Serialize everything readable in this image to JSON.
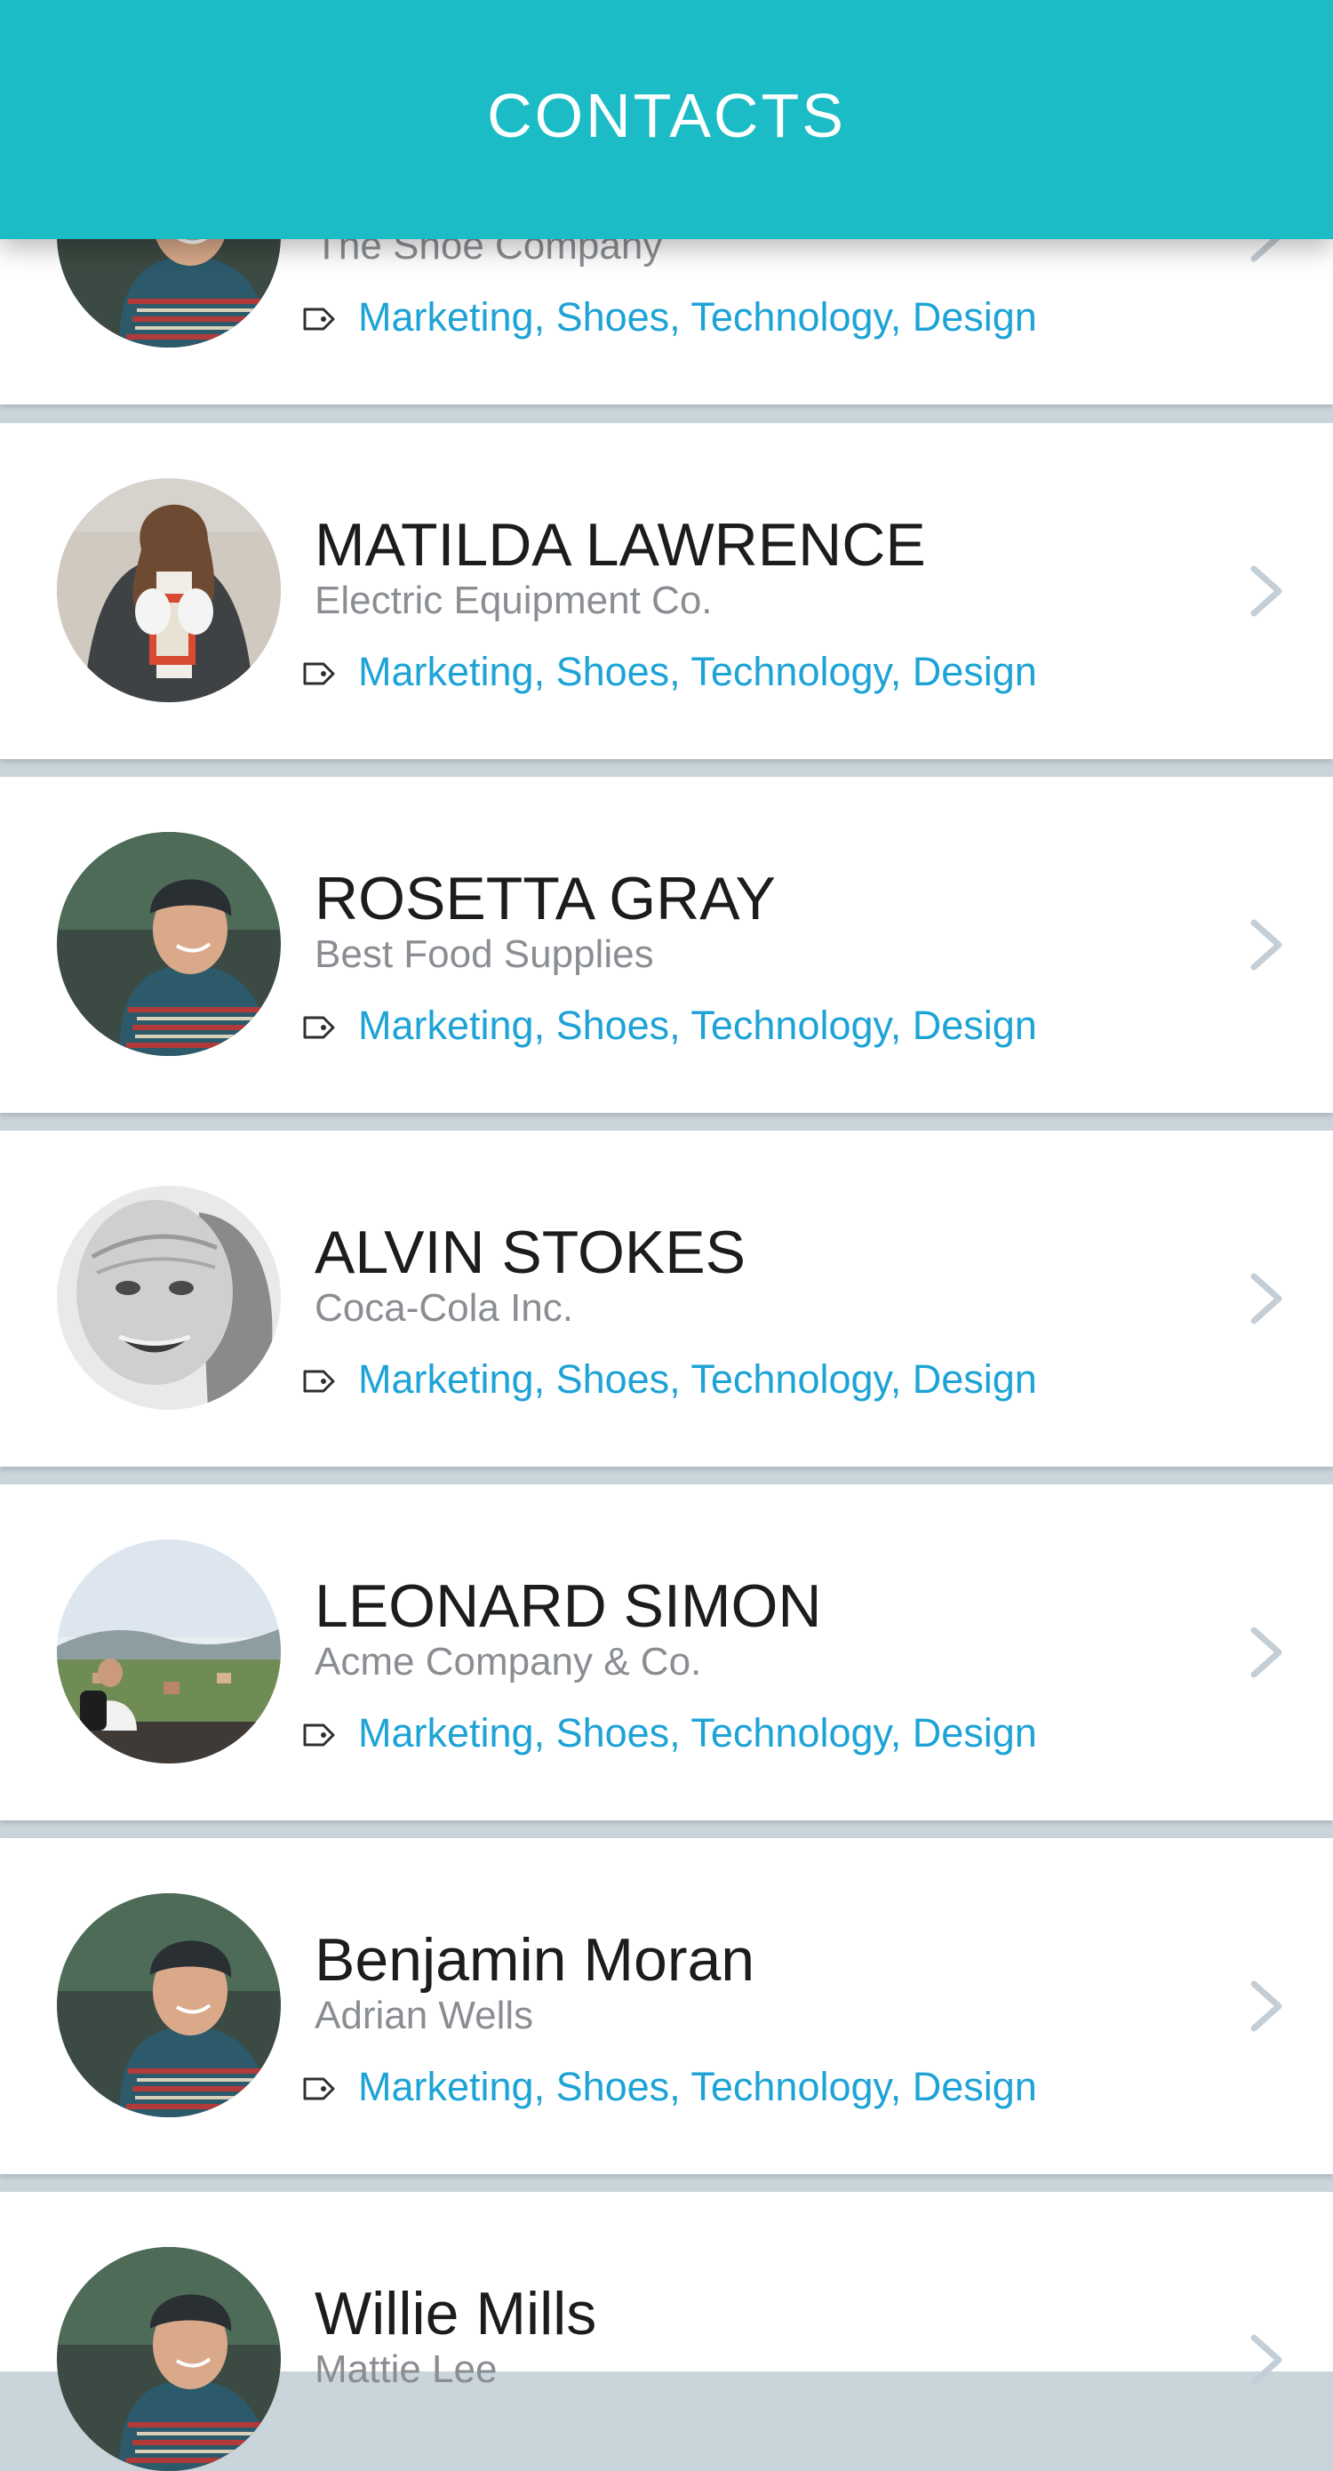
{
  "header": {
    "title": "CONTACTS"
  },
  "contacts": [
    {
      "name": "",
      "company": "The Shoe Company",
      "tags": "Marketing, Shoes, Technology, Design",
      "avatar": "young-man-beanie"
    },
    {
      "name": "MATILDA LAWRENCE",
      "company": "Electric Equipment Co.",
      "tags": "Marketing, Shoes, Technology, Design",
      "avatar": "woman-holding-book"
    },
    {
      "name": "ROSETTA GRAY",
      "company": "Best Food Supplies",
      "tags": "Marketing, Shoes, Technology, Design",
      "avatar": "young-man-beanie"
    },
    {
      "name": "ALVIN STOKES",
      "company": "Coca-Cola Inc.",
      "tags": "Marketing, Shoes, Technology, Design",
      "avatar": "elderly-woman-smiling"
    },
    {
      "name": "LEONARD SIMON",
      "company": "Acme Company & Co.",
      "tags": "Marketing, Shoes, Technology, Design",
      "avatar": "man-overlooking-city"
    },
    {
      "name": "Benjamin Moran",
      "company": "Adrian Wells",
      "tags": "Marketing, Shoes, Technology, Design",
      "avatar": "young-man-beanie"
    },
    {
      "name": "Willie Mills",
      "company": "Mattie Lee",
      "tags": "",
      "avatar": "young-man-beanie"
    }
  ],
  "colors": {
    "accent": "#1bbcc6",
    "tag_text": "#1ea3d6",
    "separator": "#c9d4db"
  }
}
